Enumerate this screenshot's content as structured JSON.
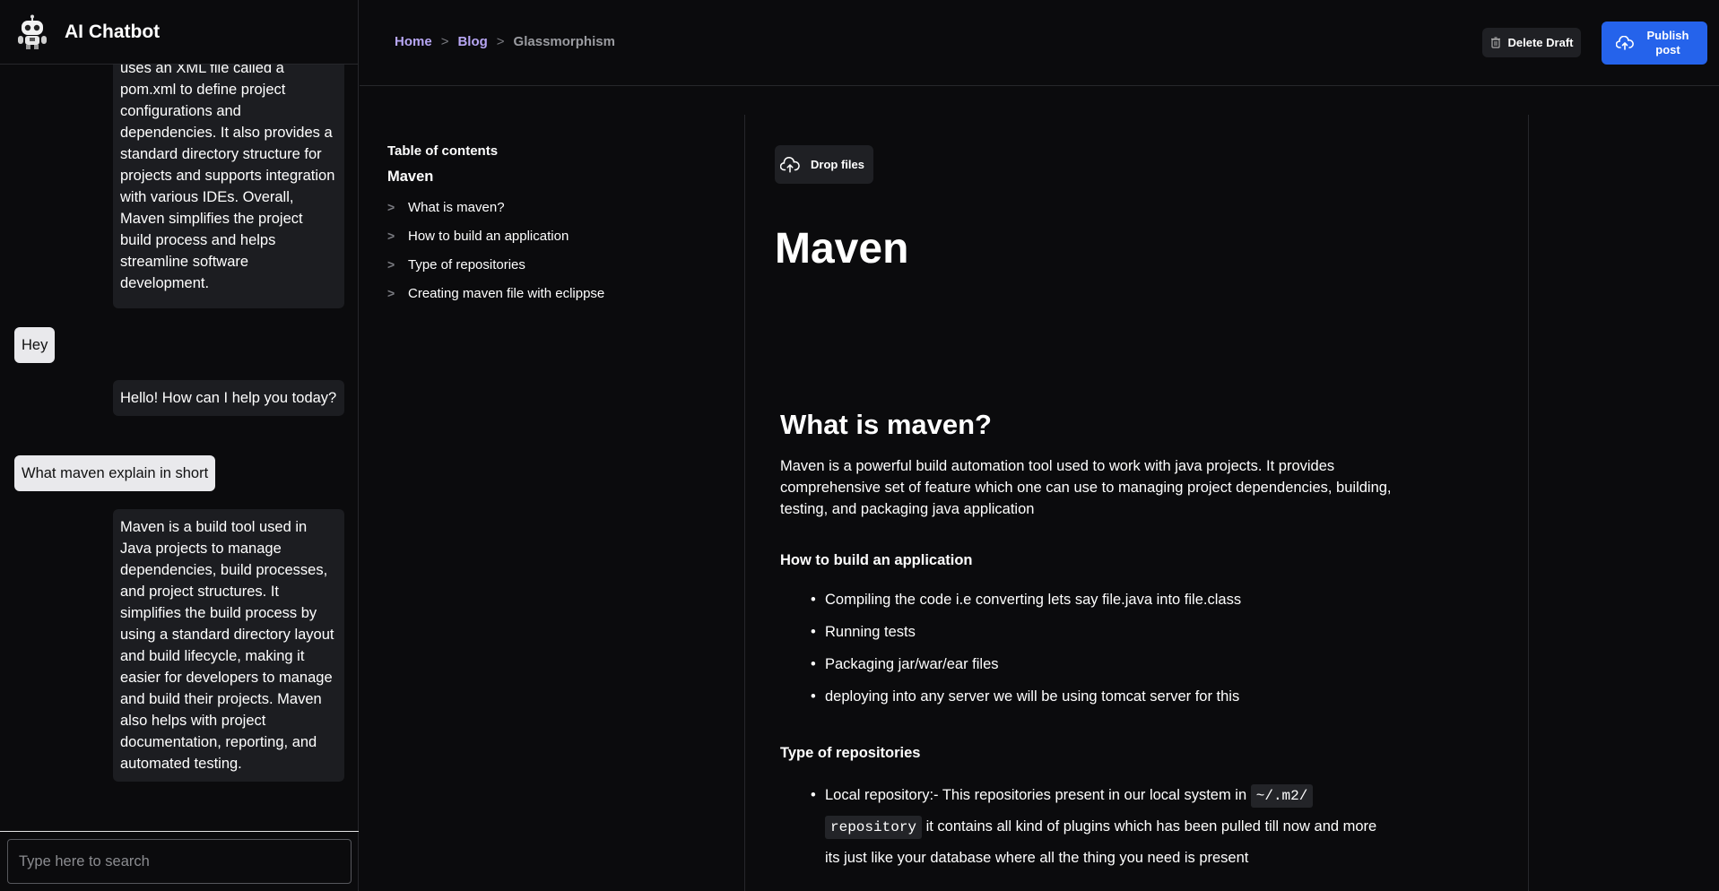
{
  "sidebar": {
    "title": "AI Chatbot",
    "messages": [
      {
        "role": "bot",
        "text": "uses an XML file called a pom.xml to define project configurations and dependencies. It also provides a standard directory structure for projects and supports integration with various IDEs. Overall, Maven simplifies the project build process and helps streamline software development."
      },
      {
        "role": "user",
        "text": "Hey"
      },
      {
        "role": "bot",
        "text": "Hello! How can I help you today?"
      },
      {
        "role": "user",
        "text": "What maven explain in short"
      },
      {
        "role": "bot",
        "text": "Maven is a build tool used in Java projects to manage dependencies, build processes, and project structures. It simplifies the build process by using a standard directory layout and build lifecycle, making it easier for developers to manage and build their projects. Maven also helps with project documentation, reporting, and automated testing."
      }
    ],
    "search_placeholder": "Type here to search"
  },
  "header": {
    "breadcrumb": [
      "Home",
      "Blog",
      "Glassmorphism"
    ],
    "breadcrumb_sep": ">",
    "delete_label": "Delete Draft",
    "publish_label": "Publish post"
  },
  "toc": {
    "title": "Table of contents",
    "main": "Maven",
    "chevron": ">",
    "items": [
      "What is maven?",
      "How to build an application",
      "Type of repositories",
      "Creating maven file with eclippse"
    ]
  },
  "editor": {
    "drop_label": "Drop files",
    "doc_title": "Maven",
    "h2": "What is maven?",
    "intro": "Maven is a powerful build automation tool used to work with java projects. It provides comprehensive set of feature which one can use to managing project dependencies, building, testing, and packaging java application",
    "build_heading": "How to build an application",
    "build_items": [
      "Compiling the code i.e converting lets say file.java into file.class",
      "Running tests",
      "Packaging jar/war/ear files",
      "deploying into any server we will be using tomcat server for this"
    ],
    "repo_heading": "Type of repositories",
    "repo_item_prefix": "Local repository:- This repositories present in our local system in ",
    "repo_item_code_1": "~/.m2/",
    "repo_item_code_2": "repository",
    "repo_item_suffix": " it contains all kind of plugins which has been pulled till now and more its just like your database where all the thing you need is present"
  },
  "colors": {
    "background": "#0b0b0d",
    "accent": "#2563eb",
    "breadcrumb_link": "#b7a6f3"
  },
  "icons": [
    "robot-icon",
    "trash-icon",
    "cloud-upload-icon",
    "chevron-right-icon"
  ]
}
